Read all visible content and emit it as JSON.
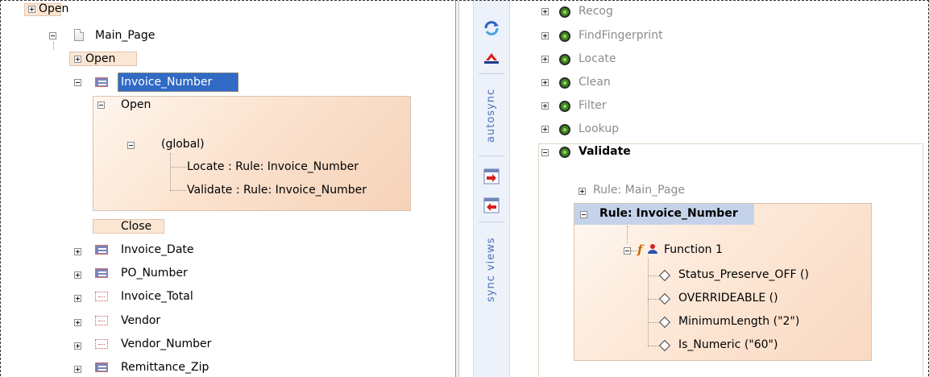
{
  "left_tree": {
    "top_open_label": "Open",
    "main_page_label": "Main_Page",
    "open_label": "Open",
    "invoice_number_label": "Invoice_Number",
    "panel": {
      "open_label": "Open",
      "global_label": "(global)",
      "locate_rule": "Locate : Rule: Invoice_Number",
      "validate_rule": "Validate : Rule: Invoice_Number"
    },
    "close_label": "Close",
    "fields": [
      "Invoice_Date",
      "PO_Number",
      "Invoice_Total",
      "Vendor",
      "Vendor_Number",
      "Remittance_Zip"
    ]
  },
  "toolbar": {
    "autosync_label": "autosync",
    "sync_views_label": "sync views"
  },
  "right_tree": {
    "steps": [
      "Recog",
      "FindFingerprint",
      "Locate",
      "Clean",
      "Filter",
      "Lookup"
    ],
    "validate_label": "Validate",
    "rule_main_page": "Rule: Main_Page",
    "rule_invoice_number": "Rule: Invoice_Number",
    "function_label": "Function 1",
    "functions": [
      "Status_Preserve_OFF ()",
      "OVERRIDEABLE ()",
      "MinimumLength (\"2\")",
      "Is_Numeric (\"60\")"
    ]
  },
  "colors": {
    "selection": "#316ac5",
    "panel_orange": "#fbe3cf",
    "rule_header": "#c5d3ea",
    "toolbar_bg": "#ecf1fa",
    "vertical_text": "#4c73b6"
  }
}
